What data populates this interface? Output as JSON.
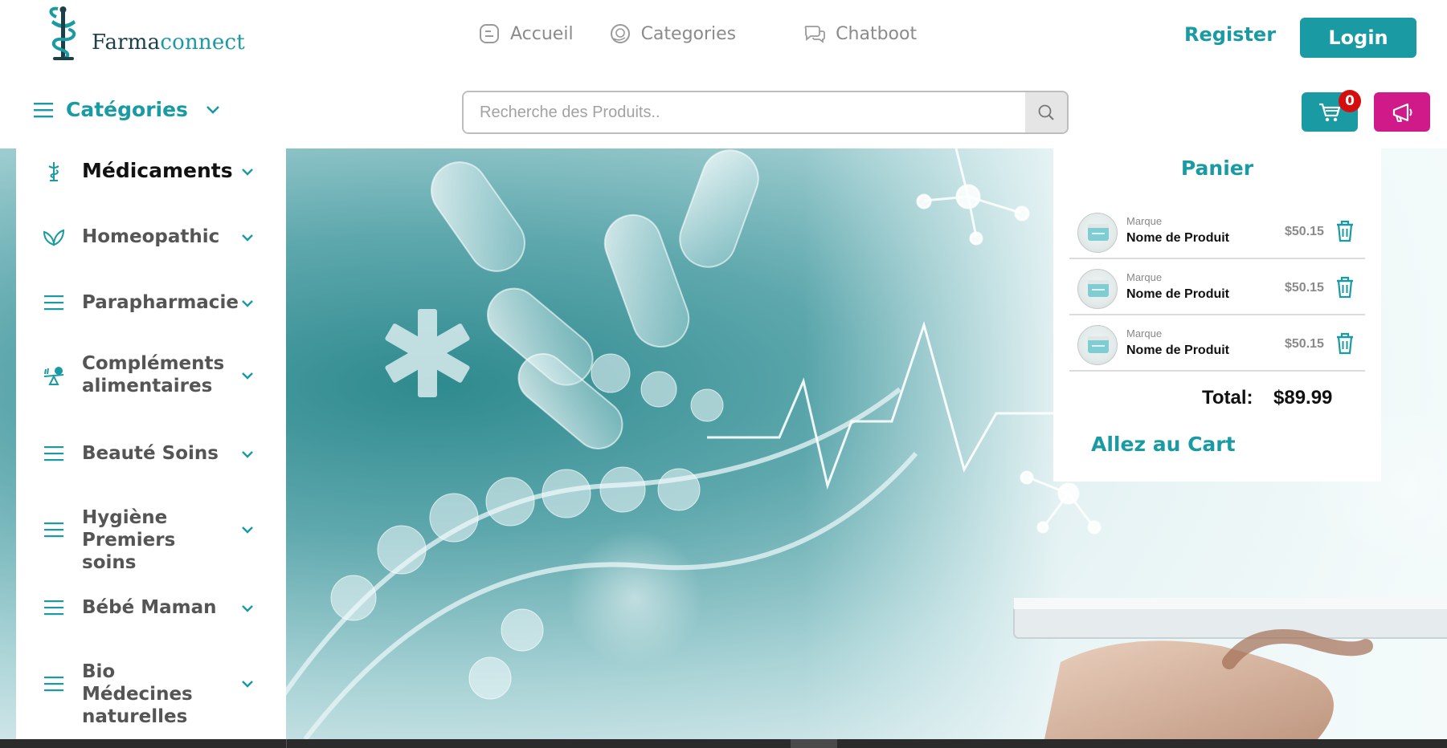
{
  "brand": {
    "name_part1": "Farma",
    "name_part2": "connect",
    "logo_icon": "caduceus-bowl-icon"
  },
  "nav": {
    "items": [
      {
        "label": "Accueil",
        "icon": "blog-icon"
      },
      {
        "label": "Categories",
        "icon": "globe-hand-icon"
      },
      {
        "label": "Chatboot",
        "icon": "chat-bubbles-icon"
      }
    ],
    "register_label": "Register",
    "login_label": "Login"
  },
  "category_toggle": {
    "label": "Catégories",
    "icon": "hamburger-icon"
  },
  "search": {
    "placeholder": "Recherche des Produits..",
    "value": ""
  },
  "cart": {
    "count": "0",
    "title": "Panier",
    "items": [
      {
        "brand": "Marque",
        "name": "Nome de Produit",
        "price": "$50.15"
      },
      {
        "brand": "Marque",
        "name": "Nome de Produit",
        "price": "$50.15"
      },
      {
        "brand": "Marque",
        "name": "Nome de Produit",
        "price": "$50.15"
      }
    ],
    "total_label": "Total:",
    "total_value": "$89.99",
    "go_to_cart_label": "Allez au Cart"
  },
  "sidebar": {
    "items": [
      {
        "label": "Médicaments",
        "icon": "caduceus-icon",
        "active": true
      },
      {
        "label": "Homeopathic",
        "icon": "leaf-icon"
      },
      {
        "label": "Parapharmacie",
        "icon": "hamburger-icon"
      },
      {
        "label": "Compléments alimentaires",
        "icon": "balance-apple-icon"
      },
      {
        "label": "Beauté Soins",
        "icon": "hamburger-icon"
      },
      {
        "label": "Hygiène Premiers soins",
        "icon": "hamburger-icon"
      },
      {
        "label": "Bébé Maman",
        "icon": "hamburger-icon"
      },
      {
        "label": "Bio Médecines naturelles",
        "icon": "hamburger-icon"
      }
    ]
  },
  "colors": {
    "primary": "#1a9aa3",
    "promo": "#d11a8a",
    "badge": "#d60d0d"
  }
}
